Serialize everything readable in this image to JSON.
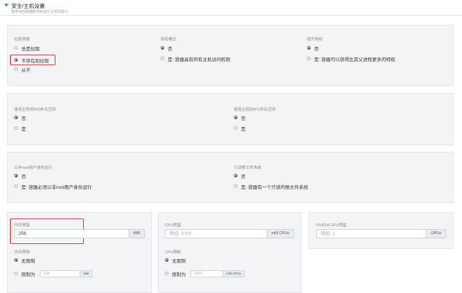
{
  "header": {
    "title": "安全/主机设置",
    "subtitle": "按手动控制器影响和运行主机的能力"
  },
  "pull": {
    "label": "拉取镜像",
    "options": [
      "总是拉取",
      "不存在则拉取",
      "从不"
    ],
    "selected": 1
  },
  "privileged": {
    "label": "特权模式",
    "options": [
      "否",
      "是: 容器具有所有主机访问权限"
    ],
    "selected": 0
  },
  "escalation": {
    "label": "提升特权",
    "options": [
      "否",
      "是: 容器可以获得比其父进程更多的特权"
    ],
    "selected": 0
  },
  "host_pid": {
    "label": "使用主机的PID命名空间",
    "options": [
      "否",
      "是"
    ],
    "selected": 0
  },
  "host_ipc": {
    "label": "使用主机的IPC命名空间",
    "options": [
      "否",
      "是"
    ],
    "selected": 0
  },
  "non_root": {
    "label": "以非root用户身份运行",
    "options": [
      "否",
      "是: 容器必须以非root用户身份运行"
    ],
    "selected": 0
  },
  "readonly_fs": {
    "label": "只读根文件系统",
    "options": [
      "否",
      "是: 容器有一个只读的根文件系统"
    ],
    "selected": 0
  },
  "memory_reservation": {
    "label": "内存预留",
    "value": "256",
    "unit": "MiB"
  },
  "memory_limit": {
    "label": "内存限制",
    "options": [
      "无限制",
      "限制为"
    ],
    "selected": 0,
    "placeholder": "128",
    "unit": "MiB"
  },
  "cpu_reservation": {
    "label": "CPU预留",
    "placeholder": "例如: 1000",
    "unit": "milli CPUs"
  },
  "cpu_limit": {
    "label": "CPU限制",
    "options": [
      "无限制",
      "限制为"
    ],
    "selected": 0,
    "placeholder": "1000",
    "unit": "milli CPUs"
  },
  "gpu_reservation": {
    "label": "NVIDIA GPU预留",
    "placeholder": "例如: 1",
    "unit": "GPUs"
  },
  "colors": {
    "panel_bg": "#f2f4f6",
    "highlight": "#e0302e",
    "accent": "#3d98d3"
  }
}
